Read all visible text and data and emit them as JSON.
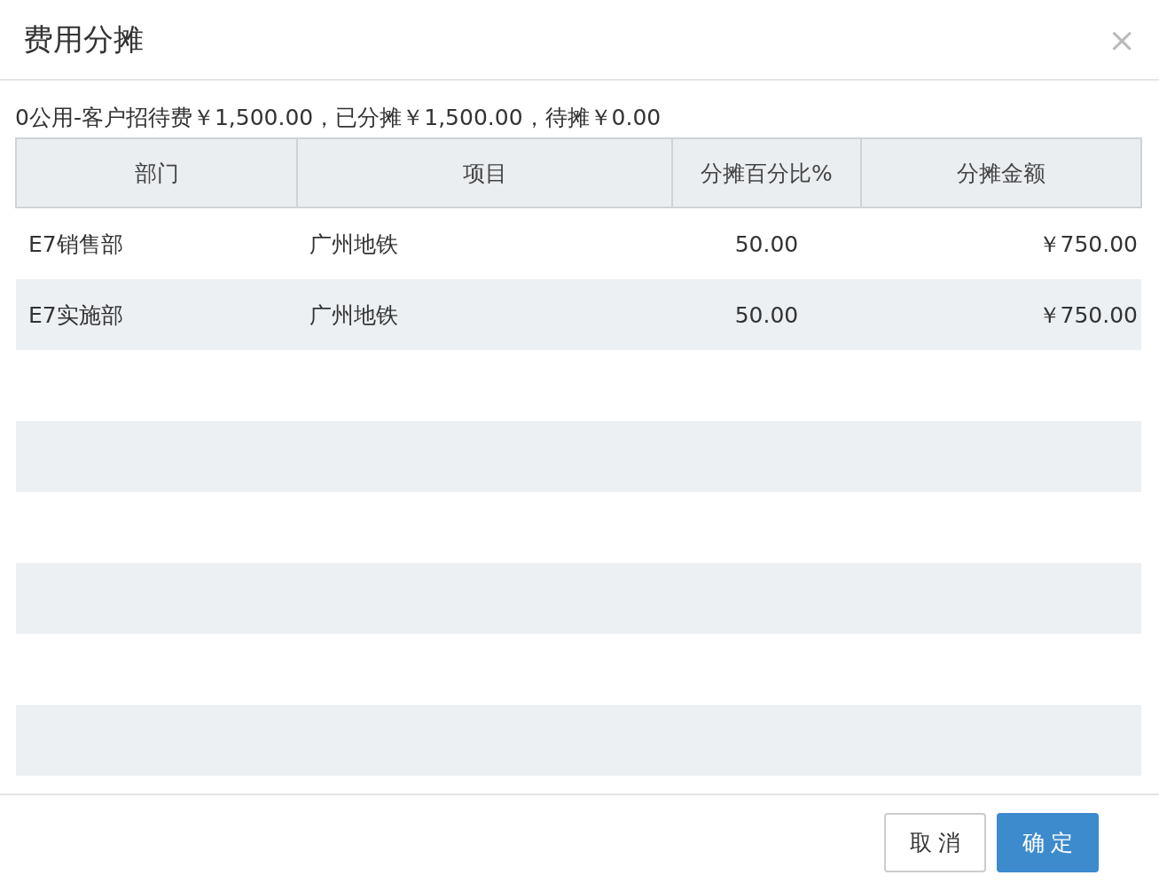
{
  "dialog": {
    "title": "费用分摊",
    "close": "×"
  },
  "summary": "0公用-客户招待费￥1,500.00，已分摊￥1,500.00，待摊￥0.00",
  "table": {
    "columns": [
      "部门",
      "项目",
      "分摊百分比%",
      "分摊金额"
    ],
    "rows": [
      {
        "cells": [
          "E7销售部",
          "广州地铁",
          "50.00",
          "￥750.00"
        ]
      },
      {
        "cells": [
          "E7实施部",
          "广州地铁",
          "50.00",
          "￥750.00"
        ]
      }
    ]
  },
  "buttons": [
    {
      "label": "取 消",
      "kind": "default"
    },
    {
      "label": "确 定",
      "kind": "primary"
    }
  ]
}
